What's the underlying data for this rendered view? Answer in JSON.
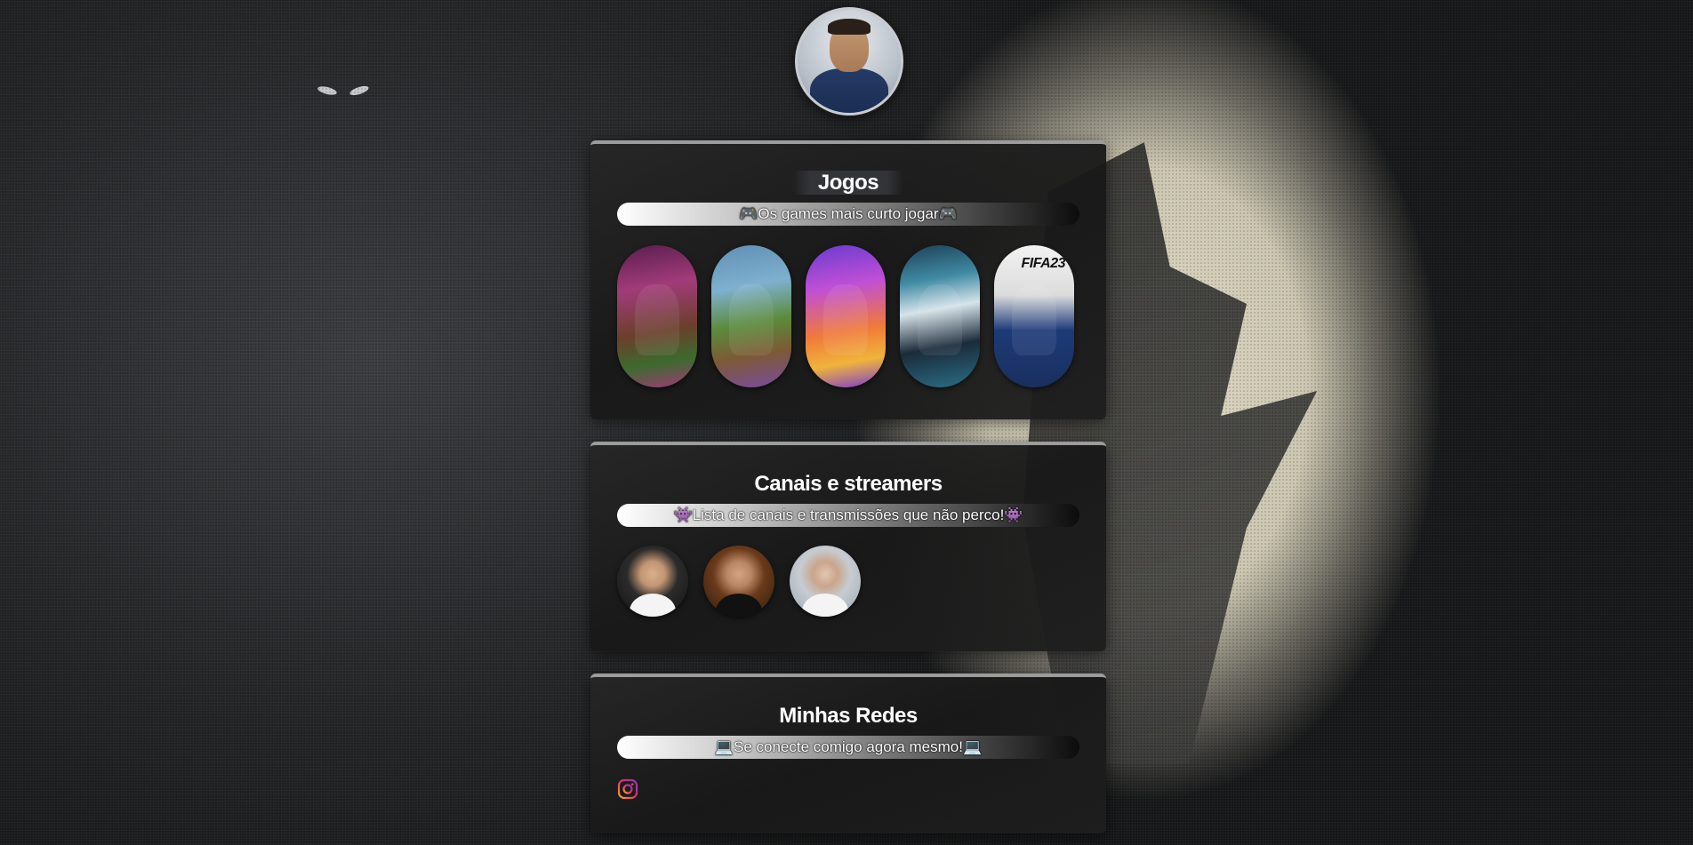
{
  "profile": {
    "avatar_icon": "profile-avatar"
  },
  "sections": {
    "games": {
      "title": "Jogos",
      "subtitle": "🎮Os games mais curto jogar🎮",
      "items": [
        {
          "icon": "minecraft-cover"
        },
        {
          "icon": "fortnite-cover"
        },
        {
          "icon": "nba2k-cover"
        },
        {
          "icon": "valorant-cover"
        },
        {
          "icon": "fifa23-cover",
          "label": "FIFA23"
        }
      ]
    },
    "streamers": {
      "title": "Canais e streamers",
      "subtitle": "👾Lista de canais e transmissões que não perco!👾",
      "items": [
        {
          "icon": "streamer-avatar-1"
        },
        {
          "icon": "streamer-avatar-2"
        },
        {
          "icon": "streamer-avatar-3"
        }
      ]
    },
    "socials": {
      "title": "Minhas Redes",
      "subtitle": "💻Se conecte comigo agora mesmo!💻",
      "links": [
        {
          "icon": "instagram-icon"
        }
      ]
    }
  },
  "colors": {
    "instagram_gradient": [
      "#f9a825",
      "#e1306c",
      "#833ab4"
    ],
    "card_border": "#9c9c9c"
  }
}
